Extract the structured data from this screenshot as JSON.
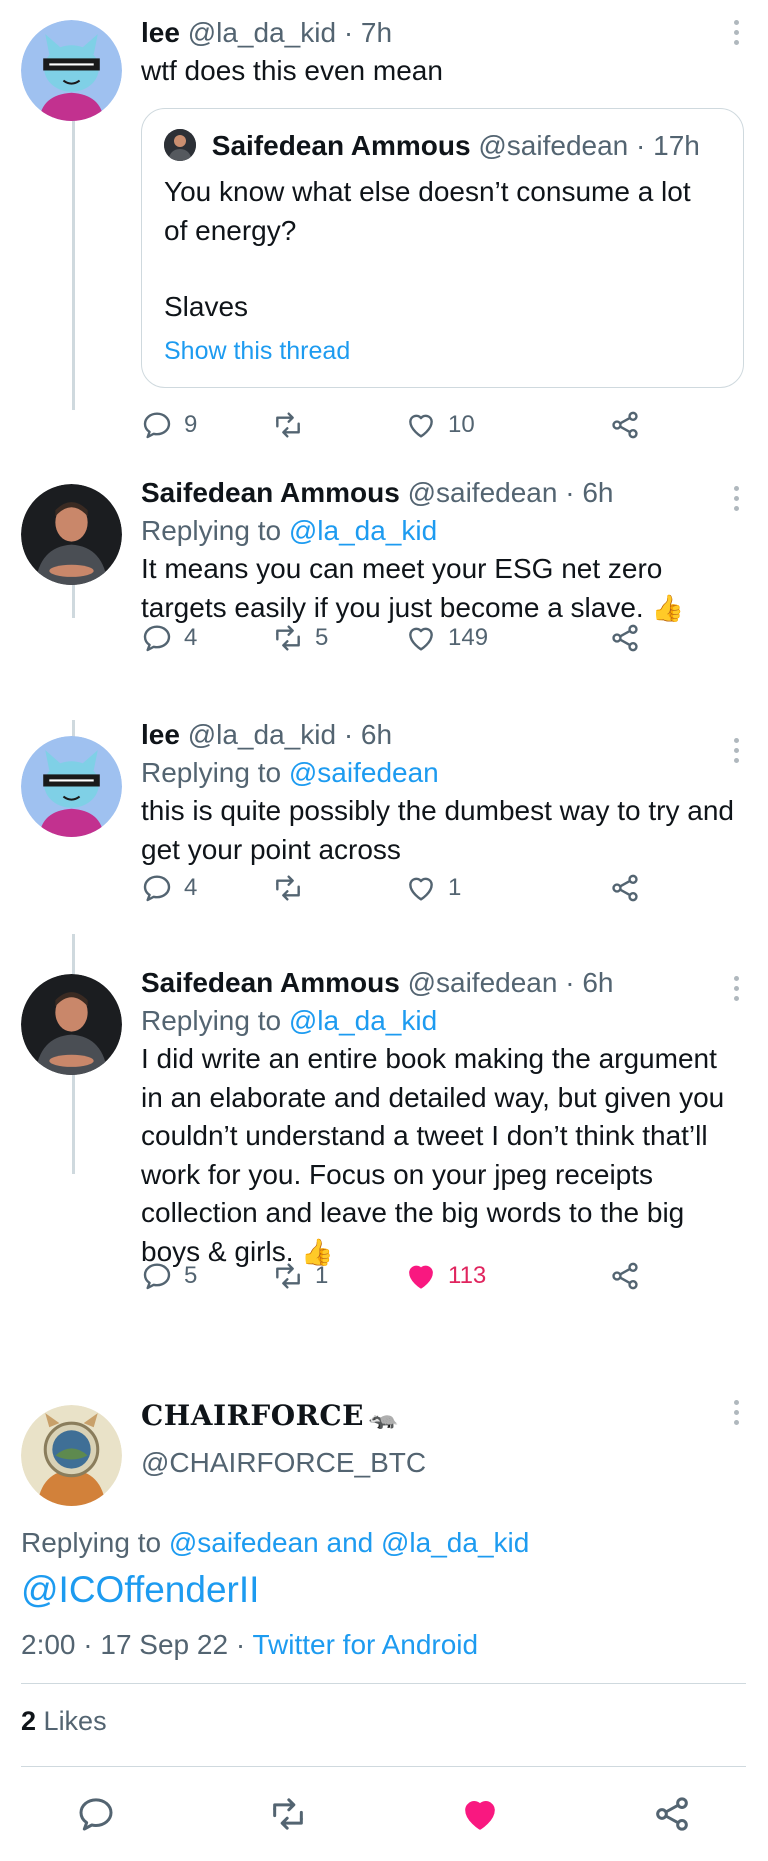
{
  "tweets": [
    {
      "name": "lee",
      "handle": "@la_da_kid",
      "time": "· 7h",
      "text": "wtf does this even mean",
      "quote": {
        "name": "Saifedean Ammous",
        "handle": "@saifedean",
        "time": "· 17h",
        "text_line1": "You know what else doesn’t consume a lot of energy?",
        "text_line2": "Slaves",
        "link": "Show this thread"
      },
      "replies": "9",
      "retweets": "",
      "likes": "10"
    },
    {
      "name": "Saifedean Ammous",
      "handle": "@saifedean",
      "time": "· 6h",
      "replying_prefix": "Replying to",
      "replying_to": "@la_da_kid",
      "text": "It means you can meet your ESG net zero targets easily if you just become a slave.",
      "emoji": "👍",
      "replies": "4",
      "retweets": "5",
      "likes": "149"
    },
    {
      "name": "lee",
      "handle": "@la_da_kid",
      "time": "· 6h",
      "replying_prefix": "Replying to",
      "replying_to": "@saifedean",
      "text": "this is quite possibly the dumbest way to try and get your point across",
      "replies": "4",
      "retweets": "",
      "likes": "1"
    },
    {
      "name": "Saifedean Ammous",
      "handle": "@saifedean",
      "time": "· 6h",
      "replying_prefix": "Replying to",
      "replying_to": "@la_da_kid",
      "text": "I did write an entire book making the argument in an elaborate and detailed way, but given you couldn’t understand a tweet I don’t think that’ll work for you. Focus on your jpeg receipts collection and leave the big words to the big boys & girls.",
      "emoji": "👍",
      "replies": "5",
      "retweets": "1",
      "likes": "113"
    }
  ],
  "main_tweet": {
    "name": "CHAIRFORCE",
    "name_emoji": "🦡",
    "handle": "@CHAIRFORCE_BTC",
    "replying_prefix": "Replying to",
    "replying_to": "@saifedean and @la_da_kid",
    "text": "@ICOffenderII",
    "time": "2:00 · 17 Sep 22 ·",
    "source": "Twitter for Android",
    "likes_count": "2",
    "likes_label": "Likes"
  },
  "colors": {
    "accent": "#1d9bf0",
    "like_active": "#e0245e",
    "muted": "#536471",
    "divider": "#cfd9de"
  },
  "icons": [
    "reply-icon",
    "retweet-icon",
    "like-icon",
    "share-icon",
    "more-icon"
  ]
}
